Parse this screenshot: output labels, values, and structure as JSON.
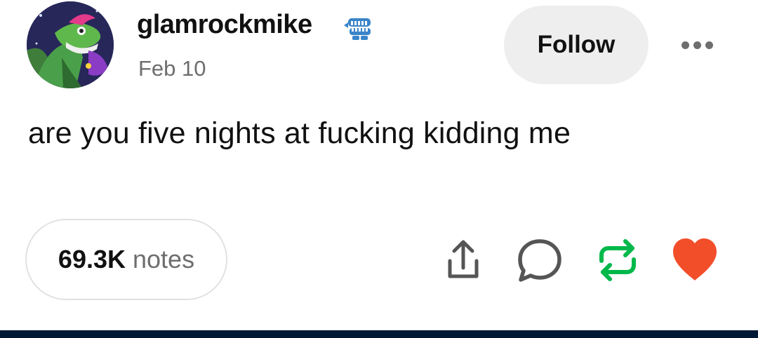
{
  "post": {
    "username": "glamrockmike",
    "date": "Feb 10",
    "body_text": "are you five nights at fucking kidding me",
    "follow_label": "Follow",
    "notes_count": "69.3K",
    "notes_label": "notes"
  },
  "icons": {
    "avatar": "profile-avatar-image",
    "badge": "chattering-teeth-badge-icon",
    "more": "more-options-icon",
    "share": "share-icon",
    "reply": "reply-bubble-icon",
    "reblog": "reblog-icon",
    "like": "heart-icon"
  },
  "colors": {
    "reblog": "#00b84a",
    "like": "#f24e2a",
    "bottom_bar": "#001935"
  }
}
